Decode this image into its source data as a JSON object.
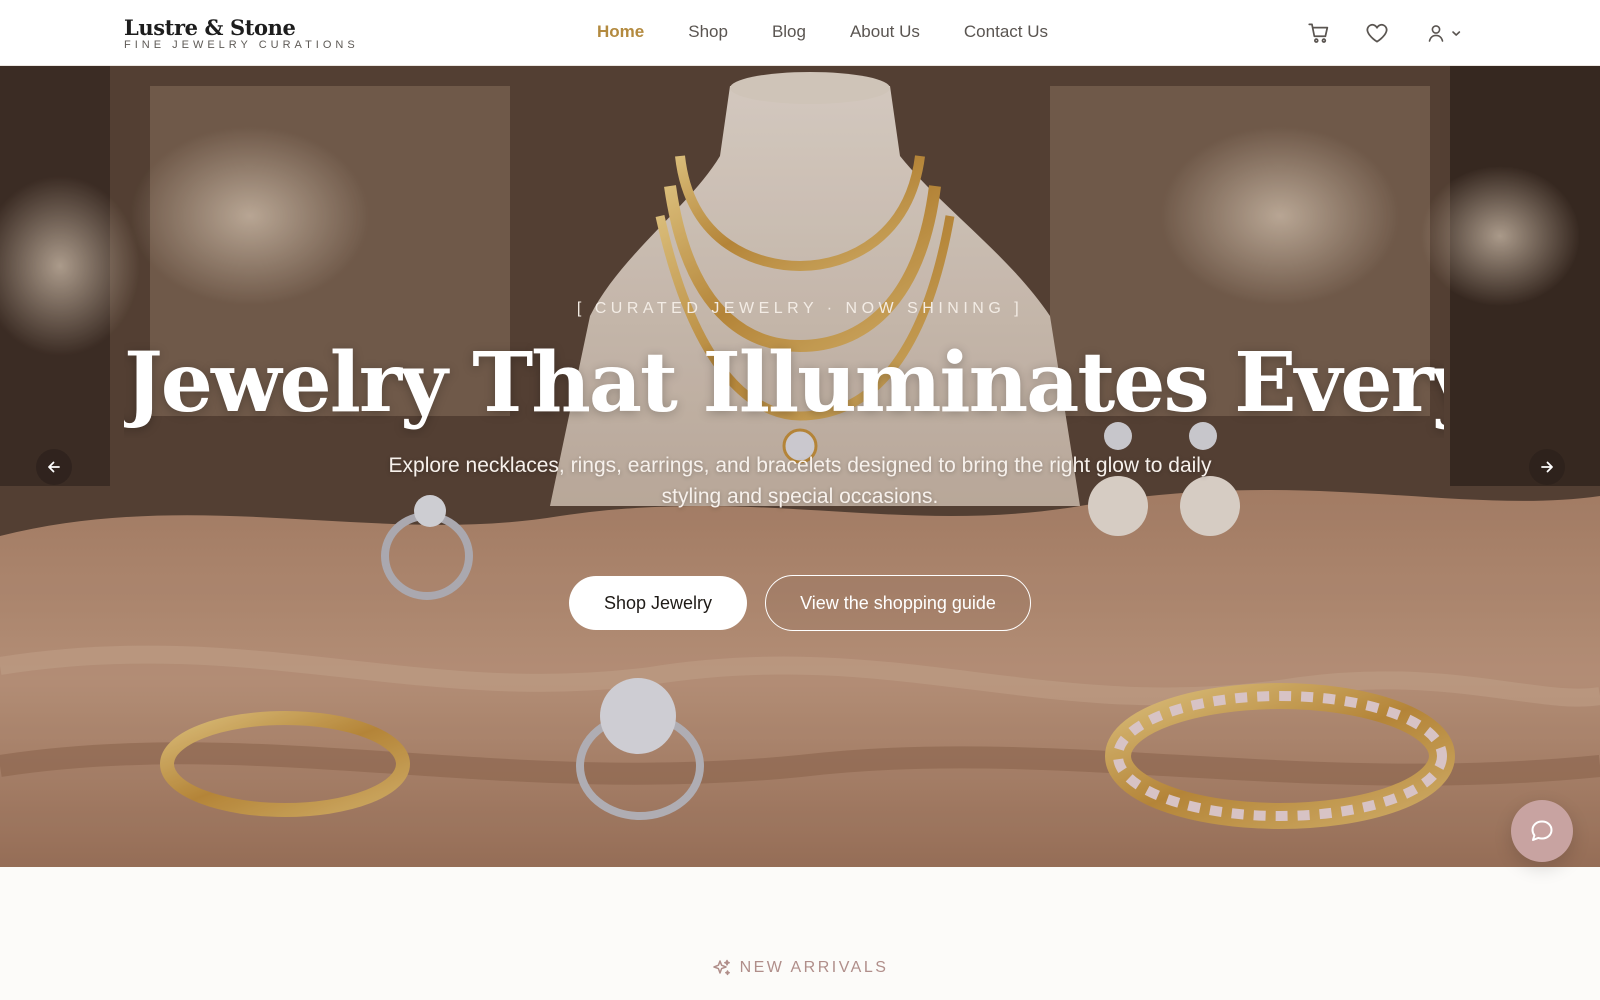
{
  "brand": {
    "name": "Lustre & Stone",
    "tagline": "FINE JEWELRY CURATIONS"
  },
  "nav": {
    "items": [
      {
        "label": "Home",
        "active": true
      },
      {
        "label": "Shop",
        "active": false
      },
      {
        "label": "Blog",
        "active": false
      },
      {
        "label": "About Us",
        "active": false
      },
      {
        "label": "Contact Us",
        "active": false
      }
    ]
  },
  "header_icons": [
    "cart-icon",
    "heart-icon",
    "user-icon",
    "chevron-down-icon"
  ],
  "hero": {
    "eyebrow": "[ CURATED JEWELRY · NOW SHINING ]",
    "title": "Jewelry That Illuminates Every Impo...",
    "subtitle": "Explore necklaces, rings, earrings, and bracelets designed to bring the right glow to daily styling and special occasions.",
    "primary_cta": "Shop Jewelry",
    "secondary_cta": "View the shopping guide"
  },
  "section": {
    "eyebrow": "NEW ARRIVALS",
    "title": ""
  },
  "colors": {
    "accent": "#b38a3f",
    "chat_button": "#c8a3a1",
    "eyebrow_rose": "#b08e8a"
  }
}
